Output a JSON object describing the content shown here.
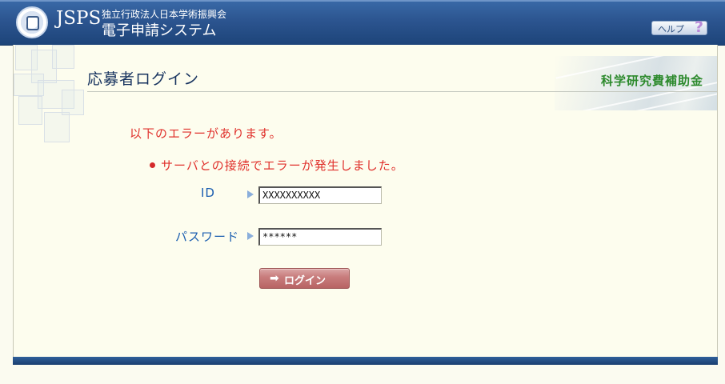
{
  "header": {
    "brand": "JSPS",
    "organization": "独立行政法人日本学術振興会",
    "system_name": "電子申請システム",
    "help_label": "ヘルプ",
    "help_icon": "question-mark-icon"
  },
  "page": {
    "title": "応募者ログイン",
    "category": "科学研究費補助金"
  },
  "errors": {
    "heading": "以下のエラーがあります。",
    "items": [
      "サーバとの接続でエラーが発生しました。"
    ]
  },
  "form": {
    "id_label": "ID",
    "id_value": "XXXXXXXXXX",
    "password_label": "パスワード",
    "password_value": "******",
    "login_label": "ログイン"
  },
  "colors": {
    "header_blue": "#2c5590",
    "error_red": "#e0302b",
    "label_blue": "#1b5eb0",
    "category_green": "#2d8a2d",
    "login_button": "#c97e7e"
  }
}
